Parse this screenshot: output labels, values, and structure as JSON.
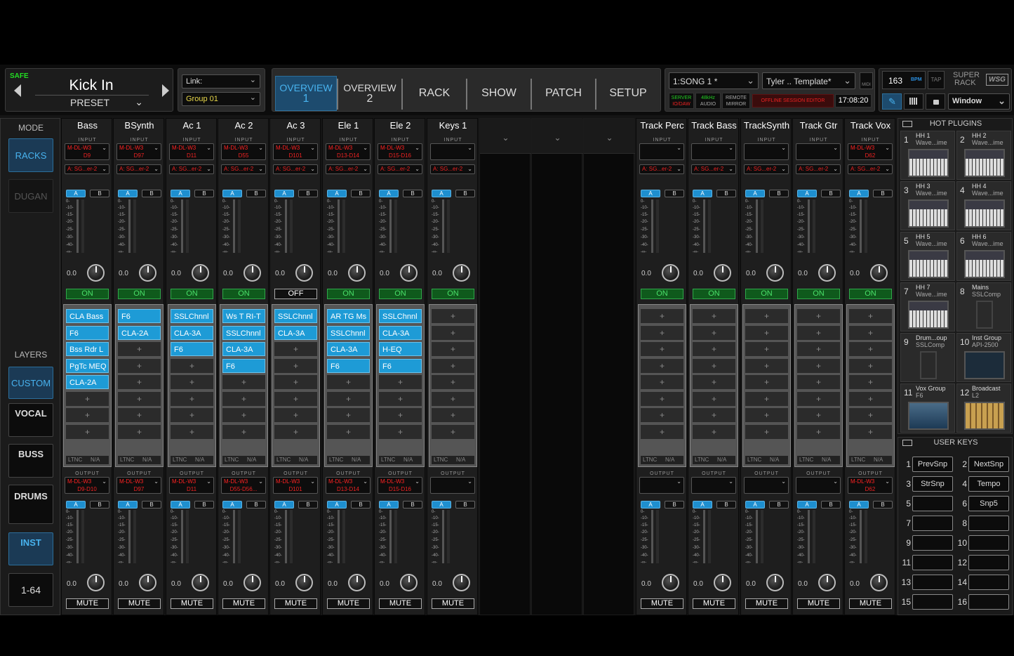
{
  "header": {
    "safe_label": "SAFE",
    "scene_name": "Kick In",
    "preset_label": "PRESET",
    "link_value": "Link:",
    "group_value": "Group 01",
    "tabs": [
      {
        "l1": "OVERVIEW",
        "l2": "1"
      },
      {
        "l1": "OVERVIEW",
        "l2": "2"
      },
      {
        "l1": "RACK",
        "l2": ""
      },
      {
        "l1": "SHOW",
        "l2": ""
      },
      {
        "l1": "PATCH",
        "l2": ""
      },
      {
        "l1": "SETUP",
        "l2": ""
      }
    ],
    "song": "1:SONG 1 *",
    "template": "Tyler .. Template*",
    "midi": "MIDI",
    "bpm_value": "163",
    "bpm_unit": "BPM",
    "tap": "TAP",
    "logo_line1": "SUPER",
    "logo_line2": "RACK",
    "logo_badge": "WSG",
    "status": {
      "server": "SERVER",
      "io": "IO/DAW",
      "rate": "48kHz",
      "audio": "AUDIO",
      "remote": "REMOTE",
      "mirror": "MIRROR",
      "offline": "OFFLINE SESSION EDITOR",
      "clock": "17:08:20"
    },
    "window_label": "Window"
  },
  "mode": {
    "title": "MODE",
    "racks": "RACKS",
    "dugan": "DUGAN",
    "layers_title": "LAYERS",
    "custom": "CUSTOM",
    "vocal": "VOCAL",
    "buss": "BUSS",
    "drums": "DRUMS",
    "inst": "INST",
    "range": "1-64"
  },
  "strip_labels": {
    "input": "INPUT",
    "output": "OUTPUT",
    "a": "A",
    "b": "B",
    "ltnc": "LTNC",
    "na": "N/A",
    "mute": "MUTE",
    "plus": "+"
  },
  "meter_ticks": [
    "0-",
    "-10-",
    "-15-",
    "-20-",
    "-25-",
    "-30-",
    "-40-",
    "-∞-"
  ],
  "strips": [
    {
      "name": "Bass",
      "in1": "M-DL-W3",
      "in2": "D9",
      "ins": "A: SG...er-2",
      "in_gain": "0.0",
      "state": "ON",
      "plugins": [
        "CLA Bass",
        "F6",
        "Bss Rdr L",
        "PgTc MEQ",
        "CLA-2A"
      ],
      "out1": "M-DL-W3",
      "out2": "D9-D10",
      "out_gain": "0.0"
    },
    {
      "name": "BSynth",
      "in1": "M-DL-W3",
      "in2": "D97",
      "ins": "A: SG...er-2",
      "in_gain": "0.0",
      "state": "ON",
      "plugins": [
        "F6",
        "CLA-2A"
      ],
      "out1": "M-DL-W3",
      "out2": "D97",
      "out_gain": "0.0"
    },
    {
      "name": "Ac 1",
      "in1": "M-DL-W3",
      "in2": "D11",
      "ins": "A: SG...er-2",
      "in_gain": "0.0",
      "state": "ON",
      "plugins": [
        "SSLChnnl",
        "CLA-3A",
        "F6"
      ],
      "out1": "M-DL-W3",
      "out2": "D11",
      "out_gain": "0.0"
    },
    {
      "name": "Ac 2",
      "in1": "M-DL-W3",
      "in2": "D55",
      "ins": "A: SG...er-2",
      "in_gain": "0.0",
      "state": "ON",
      "plugins": [
        "Ws T RI-T",
        "SSLChnnl",
        "CLA-3A",
        "F6"
      ],
      "out1": "M-DL-W3",
      "out2": "D55-D56...",
      "out_gain": "0.0"
    },
    {
      "name": "Ac 3",
      "in1": "M-DL-W3",
      "in2": "D101",
      "ins": "A: SG...er-2",
      "in_gain": "0.0",
      "state": "OFF",
      "plugins": [
        "SSLChnnl",
        "CLA-3A"
      ],
      "out1": "M-DL-W3",
      "out2": "D101",
      "out_gain": "0.0"
    },
    {
      "name": "Ele 1",
      "in1": "M-DL-W3",
      "in2": "D13-D14",
      "ins": "A: SG...er-2",
      "in_gain": "0.0",
      "state": "ON",
      "plugins": [
        "AR TG Ms",
        "SSLChnnl",
        "CLA-3A",
        "F6"
      ],
      "out1": "M-DL-W3",
      "out2": "D13-D14",
      "out_gain": "0.0"
    },
    {
      "name": "Ele 2",
      "in1": "M-DL-W3",
      "in2": "D15-D16",
      "ins": "A: SG...er-2",
      "in_gain": "0.0",
      "state": "ON",
      "plugins": [
        "SSLChnnl",
        "CLA-3A",
        "H-EQ",
        "F6"
      ],
      "out1": "M-DL-W3",
      "out2": "D15-D16",
      "out_gain": "0.0"
    },
    {
      "name": "Keys 1",
      "in1": "",
      "in2": "",
      "ins": "A: SG...er-2",
      "in_gain": "0.0",
      "state": "ON",
      "plugins": [],
      "out1": "",
      "out2": "",
      "out_gain": "0.0"
    },
    {
      "name": "Track Perc",
      "in1": "",
      "in2": "",
      "ins": "A: SG...er-2",
      "in_gain": "0.0",
      "state": "ON",
      "plugins": [],
      "out1": "",
      "out2": "",
      "out_gain": "0.0"
    },
    {
      "name": "Track Bass",
      "in1": "",
      "in2": "",
      "ins": "A: SG...er-2",
      "in_gain": "0.0",
      "state": "ON",
      "plugins": [],
      "out1": "",
      "out2": "",
      "out_gain": "0.0"
    },
    {
      "name": "TrackSynth",
      "in1": "",
      "in2": "",
      "ins": "A: SG...er-2",
      "in_gain": "0.0",
      "state": "ON",
      "plugins": [],
      "out1": "",
      "out2": "",
      "out_gain": "0.0"
    },
    {
      "name": "Track Gtr",
      "in1": "",
      "in2": "",
      "ins": "A: SG...er-2",
      "in_gain": "0.0",
      "state": "ON",
      "plugins": [],
      "out1": "",
      "out2": "",
      "out_gain": "0.0"
    },
    {
      "name": "Track Vox",
      "in1": "M-DL-W3",
      "in2": "D62",
      "ins": "A: SG...er-2",
      "in_gain": "0.0",
      "state": "ON",
      "plugins": [],
      "out1": "M-DL-W3",
      "out2": "D62",
      "out_gain": "0.0"
    }
  ],
  "hot_plugins": {
    "title": "HOT PLUGINS",
    "items": [
      {
        "n": "1",
        "t1": "HH 1",
        "t2": "Wave...ime",
        "img": "synth"
      },
      {
        "n": "2",
        "t1": "HH 2",
        "t2": "Wave...ime",
        "img": "synth"
      },
      {
        "n": "3",
        "t1": "HH 3",
        "t2": "Wave...ime",
        "img": "synth"
      },
      {
        "n": "4",
        "t1": "HH 4",
        "t2": "Wave...ime",
        "img": "synth"
      },
      {
        "n": "5",
        "t1": "HH 5",
        "t2": "Wave...ime",
        "img": "synth"
      },
      {
        "n": "6",
        "t1": "HH 6",
        "t2": "Wave...ime",
        "img": "synth"
      },
      {
        "n": "7",
        "t1": "HH 7",
        "t2": "Wave...ime",
        "img": "synth"
      },
      {
        "n": "8",
        "t1": "Mains",
        "t2": "SSLComp",
        "img": "comp"
      },
      {
        "n": "9",
        "t1": "Drum...oup",
        "t2": "SSLComp",
        "img": "comp"
      },
      {
        "n": "10",
        "t1": "Inst Group",
        "t2": "API-2500",
        "img": "api"
      },
      {
        "n": "11",
        "t1": "Vox Group",
        "t2": "F6",
        "img": "eq"
      },
      {
        "n": "12",
        "t1": "Broadcast",
        "t2": "L2",
        "img": "l2"
      }
    ]
  },
  "user_keys": {
    "title": "USER KEYS",
    "keys": [
      {
        "n": "1",
        "label": "PrevSnp"
      },
      {
        "n": "2",
        "label": "NextSnp"
      },
      {
        "n": "3",
        "label": "StrSnp"
      },
      {
        "n": "4",
        "label": "Tempo"
      },
      {
        "n": "5",
        "label": ""
      },
      {
        "n": "6",
        "label": "Snp5"
      },
      {
        "n": "7",
        "label": ""
      },
      {
        "n": "8",
        "label": ""
      },
      {
        "n": "9",
        "label": ""
      },
      {
        "n": "10",
        "label": ""
      },
      {
        "n": "11",
        "label": ""
      },
      {
        "n": "12",
        "label": ""
      },
      {
        "n": "13",
        "label": ""
      },
      {
        "n": "14",
        "label": ""
      },
      {
        "n": "15",
        "label": ""
      },
      {
        "n": "16",
        "label": ""
      }
    ]
  },
  "colors": {
    "accent": "#1e9bd6",
    "on_green": "#4ae06a",
    "routing_red": "#e22222",
    "safe_green": "#22dd22"
  }
}
